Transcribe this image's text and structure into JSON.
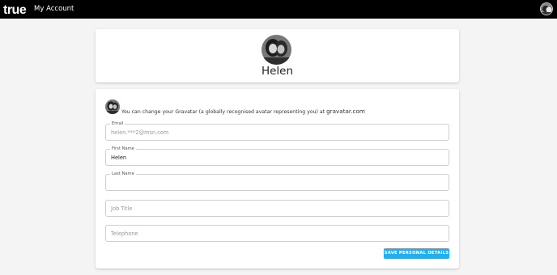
{
  "app": {
    "logo_text": "true",
    "title": "My Account"
  },
  "profile": {
    "name": "Helen"
  },
  "gravatar": {
    "note": "You can change your Gravatar (a globally recognised avatar representing you) at",
    "link_text": "gravatar.com"
  },
  "form": {
    "email": {
      "label": "Email",
      "value": "helen.***2@msn.com"
    },
    "first_name": {
      "label": "First Name",
      "value": "Helen"
    },
    "last_name": {
      "label": "Last Name",
      "value": ""
    },
    "job_title": {
      "placeholder": "Job Title"
    },
    "telephone": {
      "placeholder": "Telephone"
    },
    "save_label": "SAVE PERSONAL DETAILS"
  },
  "colors": {
    "topbar": "#000000",
    "accent_button": "#1fb0ef",
    "page_bg": "#f4f4f4"
  }
}
